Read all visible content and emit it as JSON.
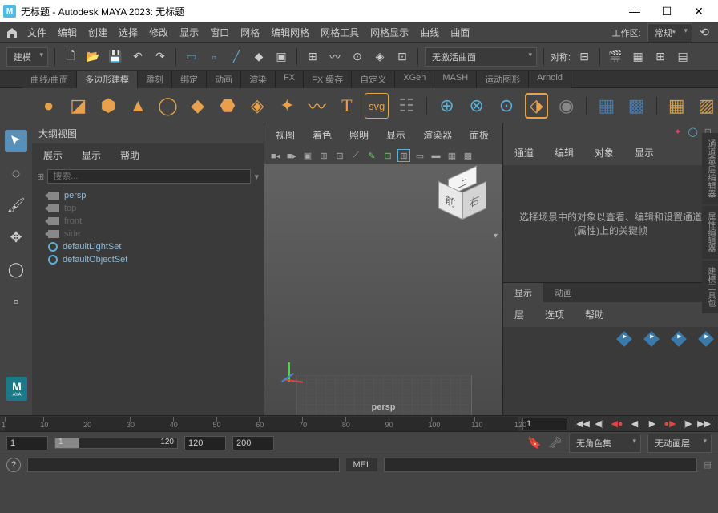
{
  "title": "无标题 - Autodesk MAYA 2023: 无标题",
  "app_badge": "M",
  "menubar": [
    "文件",
    "编辑",
    "创建",
    "选择",
    "修改",
    "显示",
    "窗口",
    "网格",
    "编辑网格",
    "网格工具",
    "网格显示",
    "曲线",
    "曲面"
  ],
  "workspace": {
    "label": "工作区:",
    "value": "常规*"
  },
  "module_dd": "建模",
  "curve_dd": "无激活曲面",
  "align_label": "对称:",
  "shelf_tabs": [
    "曲线/曲面",
    "多边形建模",
    "雕刻",
    "绑定",
    "动画",
    "渲染",
    "FX",
    "FX 缓存",
    "自定义",
    "XGen",
    "MASH",
    "运动图形",
    "Arnold"
  ],
  "shelf_active": 1,
  "outliner": {
    "title": "大纲视图",
    "menu": [
      "展示",
      "显示",
      "帮助"
    ],
    "search_placeholder": "搜索...",
    "items": [
      {
        "label": "persp",
        "type": "cam",
        "dim": false
      },
      {
        "label": "top",
        "type": "cam",
        "dim": true
      },
      {
        "label": "front",
        "type": "cam",
        "dim": true
      },
      {
        "label": "side",
        "type": "cam",
        "dim": true
      },
      {
        "label": "defaultLightSet",
        "type": "set",
        "dim": false
      },
      {
        "label": "defaultObjectSet",
        "type": "set",
        "dim": false
      }
    ]
  },
  "viewport": {
    "menu": [
      "视图",
      "着色",
      "照明",
      "显示",
      "渲染器",
      "面板"
    ],
    "camera_label": "persp",
    "cube": {
      "top": "上",
      "front": "前",
      "right": "右"
    }
  },
  "right_panel": {
    "tabs": [
      "通道",
      "编辑",
      "对象",
      "显示"
    ],
    "message": "选择场景中的对象以查看、编辑和设置通道(属性)上的关键帧",
    "lower_tabs": [
      "显示",
      "动画"
    ],
    "lower_active": 0,
    "lower_menu": [
      "层",
      "选项",
      "帮助"
    ]
  },
  "side_tabs": [
    "通道盒/层编辑器",
    "属性编辑器",
    "建模工具包"
  ],
  "timeline": {
    "ticks": [
      1,
      10,
      20,
      30,
      40,
      50,
      60,
      70,
      80,
      90,
      100,
      110,
      120
    ],
    "current": "1"
  },
  "range": {
    "start": "1",
    "inner_start": "1",
    "inner_end": "120",
    "end": "120",
    "total": "200"
  },
  "charset_dd": "无角色集",
  "anim_layer_dd": "无动画层",
  "mel_label": "MEL",
  "maya_badge_sub": "AYA"
}
